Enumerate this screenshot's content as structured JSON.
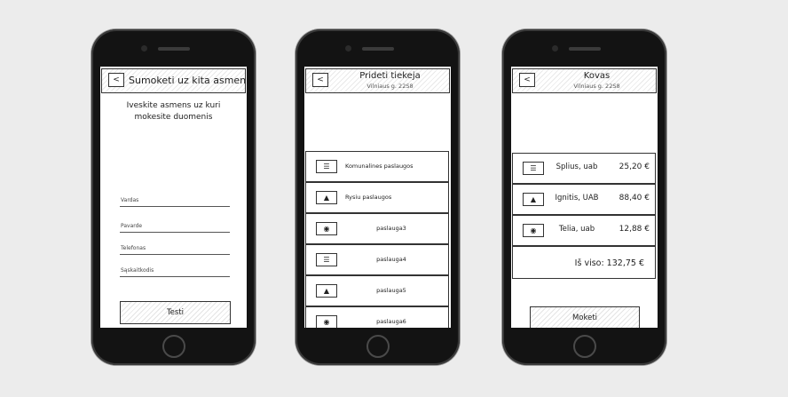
{
  "phone1": {
    "header_title": "Sumoketi uz kita asmeni",
    "back_icon": "chevron-left-icon",
    "instruction": "Iveskite asmens uz kuri mokesite duomenis",
    "fields": [
      {
        "label": "Vardas"
      },
      {
        "label": "Pavarde"
      },
      {
        "label": "Telefonas"
      },
      {
        "label": "Sąskaitkodis"
      }
    ],
    "continue_label": "Testi"
  },
  "phone2": {
    "header_title": "Prideti tiekeja",
    "header_sub": "Vilniaus g. 22S8",
    "services": [
      {
        "icon": "stack-icon",
        "label": "Komunalines paslaugos"
      },
      {
        "icon": "tree-icon",
        "label": "Rysiu paslaugos"
      },
      {
        "icon": "pig-icon",
        "label": "paslauga3"
      },
      {
        "icon": "stack-icon",
        "label": "paslauga4"
      },
      {
        "icon": "tree-icon",
        "label": "paslauga5"
      },
      {
        "icon": "pig-icon",
        "label": "paslauga6"
      }
    ]
  },
  "phone3": {
    "header_title": "Kovas",
    "header_sub": "Vilniaus g. 22S8",
    "bills": [
      {
        "icon": "stack-icon",
        "name": "Splius, uab",
        "amount": "25,20 €"
      },
      {
        "icon": "tree-icon",
        "name": "Ignitis, UAB",
        "amount": "88,40 €"
      },
      {
        "icon": "pig-icon",
        "name": "Telia, uab",
        "amount": "12,88 €"
      }
    ],
    "total": "Iš viso: 132,75 €",
    "pay_label": "Moketi"
  }
}
